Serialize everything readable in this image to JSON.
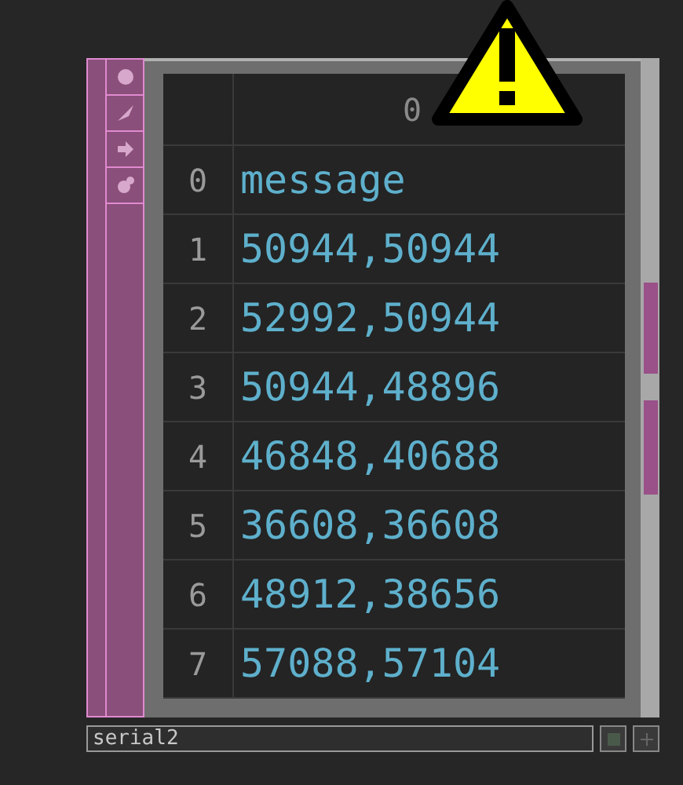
{
  "node": {
    "name": "serial2",
    "warning": true,
    "table": {
      "columns": [
        "0"
      ],
      "rows": [
        {
          "index": "0",
          "value": "message"
        },
        {
          "index": "1",
          "value": "50944,50944"
        },
        {
          "index": "2",
          "value": "52992,50944"
        },
        {
          "index": "3",
          "value": "50944,48896"
        },
        {
          "index": "4",
          "value": "46848,40688"
        },
        {
          "index": "5",
          "value": "36608,36608"
        },
        {
          "index": "6",
          "value": "48912,38656"
        },
        {
          "index": "7",
          "value": "57088,57104"
        }
      ]
    }
  }
}
